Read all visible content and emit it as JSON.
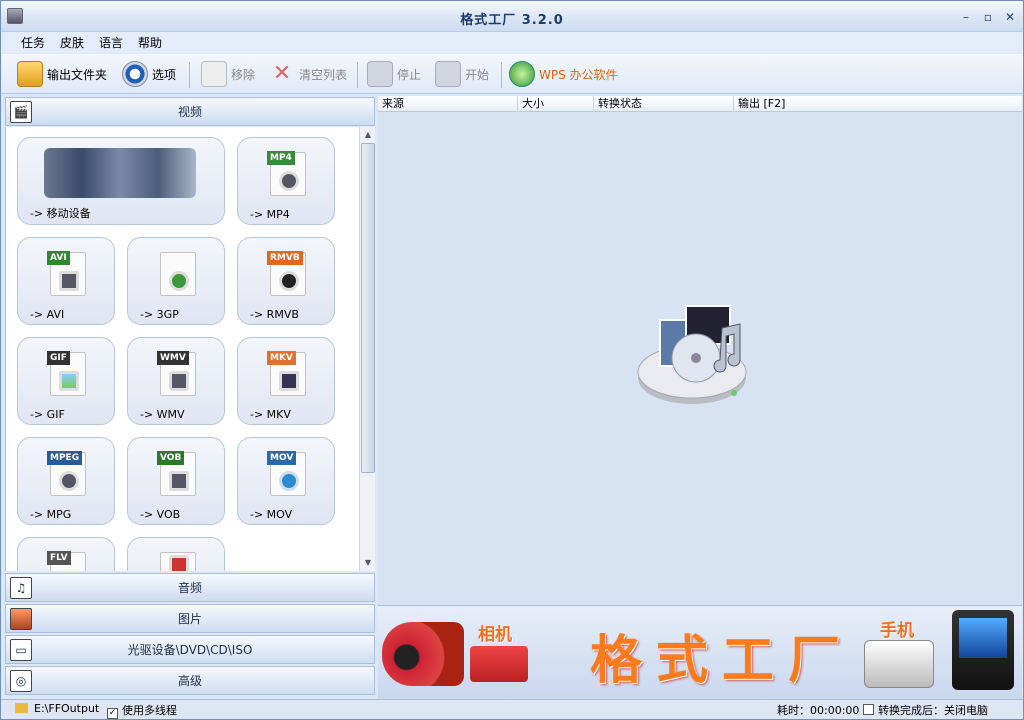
{
  "window": {
    "title": "格式工厂 3.2.0"
  },
  "menu": [
    "任务",
    "皮肤",
    "语言",
    "帮助"
  ],
  "toolbar": {
    "output_folder": "输出文件夹",
    "options": "选项",
    "remove": "移除",
    "clear": "清空列表",
    "stop": "停止",
    "start": "开始",
    "wps": "WPS 办公软件"
  },
  "categories": {
    "video": "视频",
    "audio": "音频",
    "image": "图片",
    "disc": "光驱设备\\DVD\\CD\\ISO",
    "advanced": "高级"
  },
  "tiles": [
    {
      "label": "-> 移动设备",
      "tag": ""
    },
    {
      "label": "-> MP4",
      "tag": "MP4",
      "color": "#3b8a3b"
    },
    {
      "label": "-> AVI",
      "tag": "AVI",
      "color": "#2f8a2f"
    },
    {
      "label": "-> 3GP",
      "tag": "",
      "color": "#3a9a3a"
    },
    {
      "label": "-> RMVB",
      "tag": "RMVB",
      "color": "#e06a1a"
    },
    {
      "label": "-> GIF",
      "tag": "GIF",
      "color": "#333"
    },
    {
      "label": "-> WMV",
      "tag": "WMV",
      "color": "#333"
    },
    {
      "label": "-> MKV",
      "tag": "MKV",
      "color": "#e07030"
    },
    {
      "label": "-> MPG",
      "tag": "MPEG",
      "color": "#2a5a9a"
    },
    {
      "label": "-> VOB",
      "tag": "VOB",
      "color": "#2a7a2a"
    },
    {
      "label": "-> MOV",
      "tag": "MOV",
      "color": "#2a6aaa"
    },
    {
      "label": "",
      "tag": "FLV",
      "color": "#555"
    },
    {
      "label": "",
      "tag": "",
      "color": "#c33"
    }
  ],
  "list": {
    "columns": [
      "来源",
      "大小",
      "转换状态",
      "输出 [F2]"
    ]
  },
  "banner": {
    "text": "格式工厂",
    "camera": "相机",
    "phone": "手机"
  },
  "status": {
    "output_path": "E:\\FFOutput",
    "multithread": "使用多线程",
    "elapsed": "耗时：00:00:00",
    "shutdown": "转换完成后：关闭电脑"
  }
}
